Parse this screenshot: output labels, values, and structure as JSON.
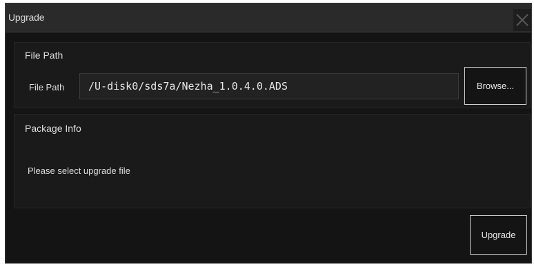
{
  "window": {
    "title": "Upgrade",
    "close_icon": "close-x-icon"
  },
  "file_path_section": {
    "heading": "File Path",
    "field_label": "File Path",
    "path_value": "/U-disk0/sds7a/Nezha_1.0.4.0.ADS",
    "browse_label": "Browse..."
  },
  "package_info_section": {
    "heading": "Package Info",
    "status_text": "Please select upgrade file"
  },
  "actions": {
    "upgrade_label": "Upgrade"
  },
  "colors": {
    "background": "#141414",
    "titlebar": "#2a2a2a",
    "text": "#dcdcdc",
    "button_border": "#cfcfcf"
  }
}
